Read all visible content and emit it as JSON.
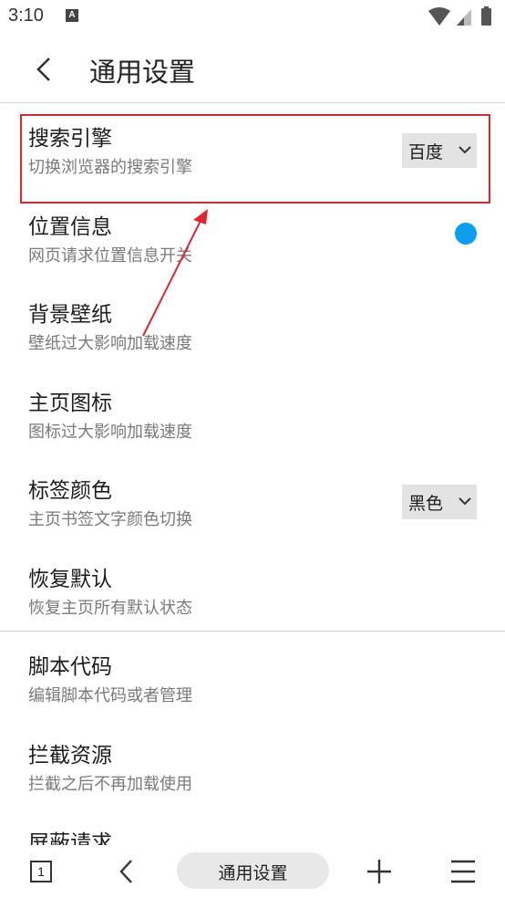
{
  "status_bar": {
    "time": "3:10",
    "notification_letter": "A"
  },
  "header": {
    "title": "通用设置"
  },
  "settings": [
    {
      "title": "搜索引擎",
      "desc": "切换浏览器的搜索引擎",
      "control": "dropdown",
      "value": "百度"
    },
    {
      "title": "位置信息",
      "desc": "网页请求位置信息开关",
      "control": "toggle"
    },
    {
      "title": "背景壁纸",
      "desc": "壁纸过大影响加载速度"
    },
    {
      "title": "主页图标",
      "desc": "图标过大影响加载速度"
    },
    {
      "title": "标签颜色",
      "desc": "主页书签文字颜色切换",
      "control": "dropdown",
      "value": "黑色"
    },
    {
      "title": "恢复默认",
      "desc": "恢复主页所有默认状态"
    },
    {
      "title": "脚本代码",
      "desc": "编辑脚本代码或者管理"
    },
    {
      "title": "拦截资源",
      "desc": "拦截之后不再加载使用"
    },
    {
      "title": "屏蔽请求",
      "desc": ""
    }
  ],
  "bottom_bar": {
    "tab_count": "1",
    "url_text": "通用设置"
  },
  "colors": {
    "accent": "#0d9ef0",
    "highlight": "#e0262f"
  }
}
